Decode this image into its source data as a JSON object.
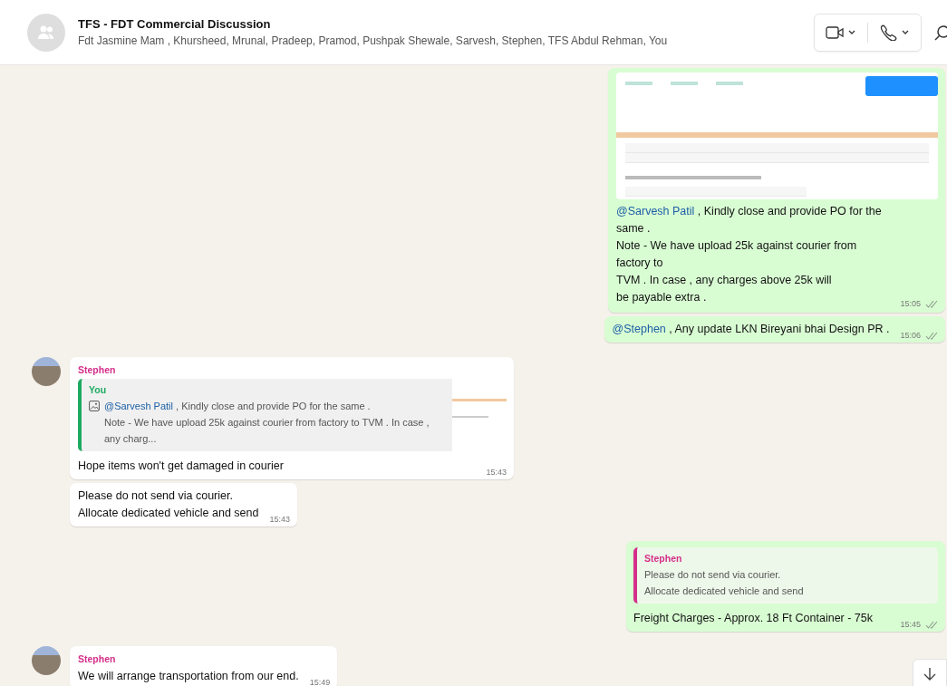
{
  "header": {
    "title": "TFS - FDT Commercial Discussion",
    "members": "Fdt Jasmine Mam , Khursheed, Mrunal, Pradeep, Pramod, Pushpak Shewale, Sarvesh, Stephen, TFS Abdul Rehman, You"
  },
  "messages": [
    {
      "kind": "outgoing-image",
      "mention": "@Sarvesh Patil",
      "text": " , Kindly close and provide PO for the same .\nNote - We have upload 25k against courier from factory to\nTVM . In case , any charges above 25k will\nbe payable extra .",
      "time": "15:05",
      "read": false
    },
    {
      "kind": "outgoing-text",
      "mention": "@Stephen",
      "text": " , Any update LKN Bireyani bhai Design PR .",
      "time": "15:06",
      "read": false
    },
    {
      "kind": "incoming-quote",
      "sender": "Stephen",
      "color": "#d42f8a",
      "quote": {
        "author": "You",
        "color": "#1daa61",
        "image": true,
        "mention": "@Sarvesh Patil",
        "text": " , Kindly close and provide PO for the same .\nNote - We have upload 25k against courier from factory to TVM . In case , any charg..."
      },
      "text": "Hope items won't get damaged in courier",
      "time": "15:43"
    },
    {
      "kind": "incoming-text",
      "text": "Please do not send via courier.\nAllocate dedicated vehicle and send",
      "time": "15:43"
    },
    {
      "kind": "outgoing-quote",
      "quote": {
        "author": "Stephen",
        "color": "#d42f8a",
        "image": false,
        "text": "Please do not send via courier.\nAllocate dedicated vehicle and send"
      },
      "text": "Freight Charges - Approx. 18 Ft Container  - 75k",
      "time": "15:45",
      "read": false
    },
    {
      "kind": "incoming-text",
      "sender": "Stephen",
      "color": "#d42f8a",
      "text": "We will arrange transportation from our end.",
      "time": "15:49"
    }
  ]
}
